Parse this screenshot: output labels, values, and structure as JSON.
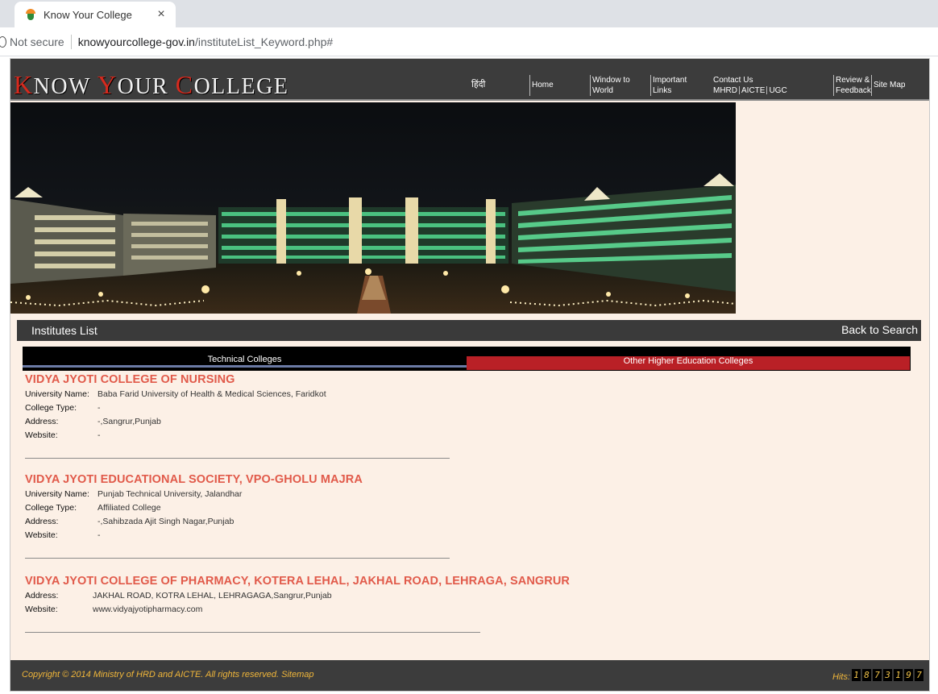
{
  "browser": {
    "tab_title": "Know Your College",
    "security_label": "Not secure",
    "url_host": "knowyourcollege-gov.in",
    "url_path": "/instituteList_Keyword.php#"
  },
  "header": {
    "logo_parts": [
      "K",
      "NOW ",
      "Y",
      "OUR ",
      "C",
      "OLLEGE"
    ],
    "nav": {
      "hindi": "हिंदी",
      "home": "Home",
      "window_line1": "Window to",
      "window_line2": "World",
      "important_line1": "Important",
      "important_line2": "Links",
      "contact": "Contact Us",
      "mhrd": "MHRD",
      "aicte": "AICTE",
      "ugc": "UGC",
      "review_line1": "Review &",
      "review_line2": "Feedback",
      "sitemap": "Site Map"
    }
  },
  "list_header": {
    "title": "Institutes List",
    "back": "Back to Search"
  },
  "tabs": {
    "technical": "Technical Colleges",
    "other": "Other Higher Education Colleges"
  },
  "entries": [
    {
      "name": "VIDYA JYOTI COLLEGE OF NURSING",
      "university_label": "University Name:",
      "university": "Baba Farid University of Health & Medical Sciences, Faridkot",
      "type_label": "College Type:",
      "type": "-",
      "address_label": "Address:",
      "address": "-,Sangrur,Punjab",
      "website_label": "Website:",
      "website": "-"
    },
    {
      "name": "VIDYA JYOTI EDUCATIONAL SOCIETY, VPO-GHOLU MAJRA",
      "university_label": "University Name:",
      "university": "Punjab Technical University, Jalandhar",
      "type_label": "College Type:",
      "type": "Affiliated College",
      "address_label": "Address:",
      "address": "-,Sahibzada Ajit Singh Nagar,Punjab",
      "website_label": "Website:",
      "website": "-"
    },
    {
      "name": "VIDYA JYOTI COLLEGE OF PHARMACY, KOTERA LEHAL, JAKHAL ROAD, LEHRAGA, SANGRUR",
      "address_label": "Address:",
      "address": "JAKHAL ROAD, KOTRA LEHAL, LEHRAGAGA,Sangrur,Punjab",
      "website_label": "Website:",
      "website": "www.vidyajyotipharmacy.com"
    }
  ],
  "footer": {
    "copyright": "Copyright © 2014 Ministry of HRD and AICTE. All rights reserved. Sitemap",
    "hits_label": "Hits:",
    "hits_digits": [
      "1",
      "8",
      "7",
      "3",
      "1",
      "9",
      "7"
    ]
  },
  "colors": {
    "accent_title": "#e15a4a",
    "nav_bg": "#3c3c3c",
    "tab_other_bg": "#b92026",
    "footer_text": "#f0b63a",
    "page_bg": "#fcf0e6"
  }
}
